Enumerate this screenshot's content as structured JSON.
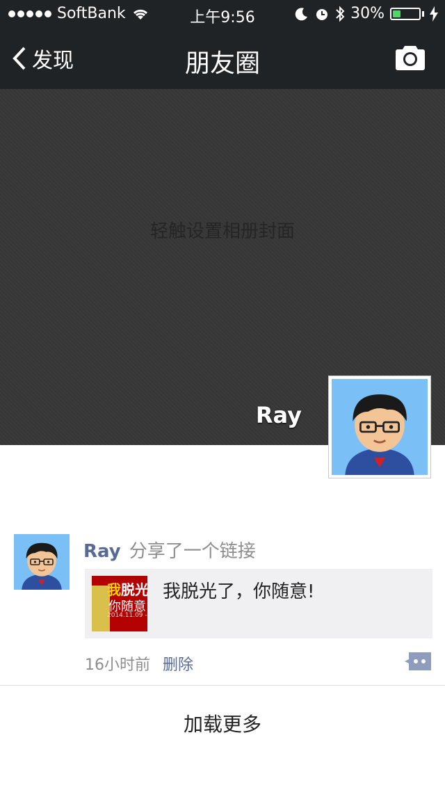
{
  "status_bar": {
    "carrier": "SoftBank",
    "time": "上午9:56",
    "battery_percent_text": "30%",
    "battery_level": 0.3
  },
  "nav": {
    "back_label": "发现",
    "title": "朋友圈"
  },
  "cover": {
    "hint": "轻触设置相册封面",
    "user_name": "Ray"
  },
  "post": {
    "author": "Ray",
    "action": "分享了一个链接",
    "link": {
      "text": "我脱光了，你随意!",
      "thumb_line1_a": "我",
      "thumb_line1_b": "脱光",
      "thumb_line2": "你随意",
      "thumb_date": "2014.11.09 - 20"
    },
    "time": "16小时前",
    "delete_label": "删除"
  },
  "load_more_label": "加载更多",
  "colors": {
    "bar": "#202326",
    "link_blue": "#586b95",
    "battery_green": "#4cd964"
  }
}
